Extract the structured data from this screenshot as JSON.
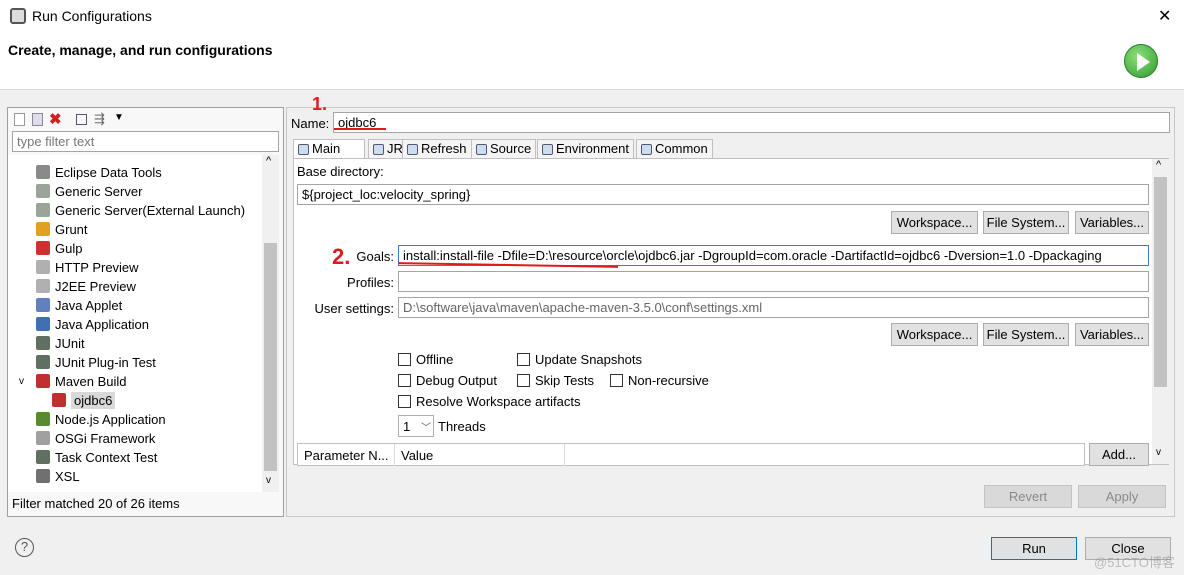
{
  "window": {
    "title": "Run Configurations",
    "close": "✕"
  },
  "header": {
    "title": "Create, manage, and run configurations",
    "run_icon": "run-play-icon"
  },
  "left": {
    "toolbar_icons": [
      "new-config-icon",
      "duplicate-icon",
      "delete-icon",
      "collapse-all-icon",
      "filter-icon",
      "dropdown-arrow-icon"
    ],
    "filter_placeholder": "type filter text",
    "items": [
      {
        "label": "Eclipse Data Tools",
        "icon": "database-icon",
        "color": "#8a8a8a"
      },
      {
        "label": "Generic Server",
        "icon": "server-icon",
        "color": "#9aa59a"
      },
      {
        "label": "Generic Server(External Launch)",
        "icon": "server-icon",
        "color": "#9aa59a"
      },
      {
        "label": "Grunt",
        "icon": "grunt-icon",
        "color": "#e0a020"
      },
      {
        "label": "Gulp",
        "icon": "gulp-icon",
        "color": "#d03030"
      },
      {
        "label": "HTTP Preview",
        "icon": "http-icon",
        "color": "#b0b0b0"
      },
      {
        "label": "J2EE Preview",
        "icon": "j2ee-icon",
        "color": "#b0b0b0"
      },
      {
        "label": "Java Applet",
        "icon": "applet-icon",
        "color": "#6080c0"
      },
      {
        "label": "Java Application",
        "icon": "java-app-icon",
        "color": "#4070b0"
      },
      {
        "label": "JUnit",
        "icon": "junit-icon",
        "color": "#607060"
      },
      {
        "label": "JUnit Plug-in Test",
        "icon": "junit-plugin-icon",
        "color": "#607060"
      },
      {
        "label": "Maven Build",
        "icon": "maven-icon",
        "color": "#c03030",
        "expanded": true
      },
      {
        "label": "ojdbc6",
        "icon": "maven-icon",
        "color": "#c03030",
        "child": true,
        "selected": true
      },
      {
        "label": "Node.js Application",
        "icon": "nodejs-icon",
        "color": "#5a8a30"
      },
      {
        "label": "OSGi Framework",
        "icon": "osgi-icon",
        "color": "#a0a0a0"
      },
      {
        "label": "Task Context Test",
        "icon": "task-test-icon",
        "color": "#607060"
      },
      {
        "label": "XSL",
        "icon": "xsl-icon",
        "color": "#707070"
      }
    ],
    "status": "Filter matched 20 of 26 items"
  },
  "main": {
    "name_label": "Name:",
    "name_value": "ojdbc6",
    "tabs": [
      {
        "label": "Main",
        "icon": "main-tab-icon"
      },
      {
        "label": "JRE",
        "icon": "jre-icon"
      },
      {
        "label": "Refresh",
        "icon": "refresh-icon"
      },
      {
        "label": "Source",
        "icon": "source-icon"
      },
      {
        "label": "Environment",
        "icon": "environment-icon"
      },
      {
        "label": "Common",
        "icon": "common-icon"
      }
    ],
    "base_dir_label": "Base directory:",
    "base_dir_value": "${project_loc:velocity_spring}",
    "workspace": "Workspace...",
    "file_system": "File System...",
    "variables": "Variables...",
    "goals_label": "Goals:",
    "goals_value": "install:install-file  -Dfile=D:\\resource\\orcle\\ojdbc6.jar  -DgroupId=com.oracle  -DartifactId=ojdbc6 -Dversion=1.0 -Dpackaging",
    "profiles_label": "Profiles:",
    "profiles_value": "",
    "user_settings_label": "User settings:",
    "user_settings_value": "D:\\software\\java\\maven\\apache-maven-3.5.0\\conf\\settings.xml",
    "checkboxes": {
      "offline": "Offline",
      "update_snapshots": "Update Snapshots",
      "debug_output": "Debug Output",
      "skip_tests": "Skip Tests",
      "non_recursive": "Non-recursive",
      "resolve_workspace": "Resolve Workspace artifacts"
    },
    "threads_value": "1",
    "threads_label": "Threads",
    "param_columns": [
      "Parameter N...",
      "Value"
    ],
    "add": "Add...",
    "revert": "Revert",
    "apply": "Apply"
  },
  "annotations": {
    "one": "1.",
    "two": "2."
  },
  "footer": {
    "help_icon": "help-icon",
    "run": "Run",
    "close": "Close"
  },
  "watermark": "@51CTO博客"
}
